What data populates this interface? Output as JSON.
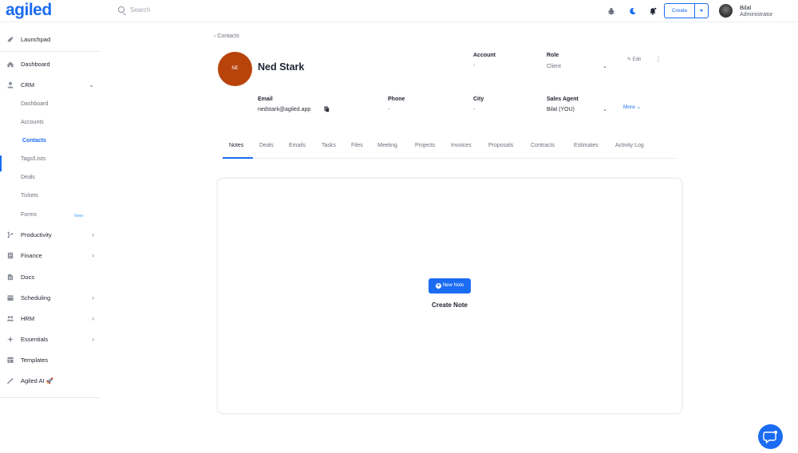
{
  "brand": {
    "logo": "agiled",
    "accent_color": "#1b6cf2",
    "avatar_color": "#b8440c"
  },
  "topbar": {
    "search_placeholder": "Search",
    "create_label": "Create",
    "user_name": "Bilal",
    "user_role": "Administrator",
    "icons": [
      "bug-icon",
      "moon-icon",
      "bell-icon",
      "search-icon"
    ]
  },
  "sidebar": {
    "launchpad": "Launchpad",
    "dashboard": "Dashboard",
    "crm": "CRM",
    "crm_items": [
      "Dashboard",
      "Accounts",
      "Contacts",
      "Tags/Lists",
      "Deals",
      "Tickets",
      "Forms"
    ],
    "forms_badge": "New",
    "productivity": "Productivity",
    "finance": "Finance",
    "docs": "Docs",
    "scheduling": "Scheduling",
    "hrm": "HRM",
    "essentials": "Essentials",
    "templates": "Templates",
    "agiled_ai": "Agiled AI 🚀"
  },
  "contact": {
    "breadcrumb": "Contacts",
    "initials": "NE",
    "name": "Ned Stark",
    "account_label": "Account",
    "account_value": "-",
    "role_label": "Role",
    "role_value": "Client",
    "email_label": "Email",
    "email_value": "nedstark@agiled.app",
    "phone_label": "Phone",
    "phone_value": "-",
    "city_label": "City",
    "city_value": "-",
    "sales_agent_label": "Sales Agent",
    "sales_agent_value": "Bilal (YOU)",
    "edit_label": "Edit",
    "more_label": "More"
  },
  "tabs": [
    "Notes",
    "Deals",
    "Emails",
    "Tasks",
    "Files",
    "Meeting",
    "Projects",
    "Invoices",
    "Proposals",
    "Contracts",
    "Estimates",
    "Activity Log"
  ],
  "notes": {
    "new_note_label": "New Note",
    "empty_title": "Create Note"
  }
}
